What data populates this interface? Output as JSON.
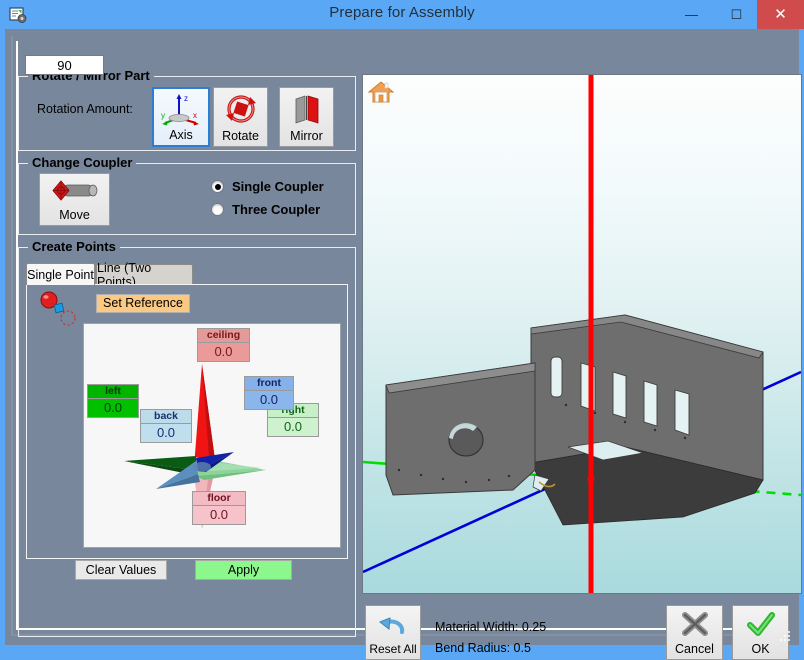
{
  "window": {
    "title": "Prepare for Assembly",
    "icon": "app-document-gear-icon",
    "minimize_label": "–",
    "maximize_label": "▭",
    "close_label": "✕"
  },
  "rotate_mirror_group": {
    "title": "Rotate / Mirror Part",
    "rotation_amount_label": "Rotation Amount:",
    "rotation_amount_value": "90",
    "buttons": [
      {
        "label": "Axis",
        "icon": "xyz-axis-icon",
        "selected": true
      },
      {
        "label": "Rotate",
        "icon": "circular-rotate-icon",
        "selected": false
      },
      {
        "label": "Mirror",
        "icon": "mirror-planes-icon",
        "selected": false
      }
    ]
  },
  "change_coupler_group": {
    "title": "Change Coupler",
    "move_button_label": "Move",
    "move_button_icon": "move-coupler-icon",
    "options": [
      {
        "label": "Single Coupler",
        "selected": true
      },
      {
        "label": "Three Coupler",
        "selected": false
      }
    ]
  },
  "create_points_group": {
    "title": "Create Points",
    "tabs": [
      {
        "label": "Single Point",
        "active": true
      },
      {
        "label": "Line (Two Points)",
        "active": false
      }
    ],
    "reference_icon": "point-reference-icon",
    "set_reference_label": "Set Reference",
    "axis_values": [
      {
        "key": "ceiling",
        "name": "ceiling",
        "value": "0.0"
      },
      {
        "key": "floor",
        "name": "floor",
        "value": "0.0"
      },
      {
        "key": "left",
        "name": "left",
        "value": "0.0"
      },
      {
        "key": "right",
        "name": "right",
        "value": "0.0"
      },
      {
        "key": "front",
        "name": "front",
        "value": "0.0"
      },
      {
        "key": "back",
        "name": "back",
        "value": "0.0"
      }
    ],
    "clear_values_label": "Clear Values",
    "apply_label": "Apply"
  },
  "viewport": {
    "home_icon": "home-icon",
    "model": "sheet-metal-bracket",
    "axis_colors": {
      "vertical": "#ff0000",
      "horizontal": "#00e000",
      "depth": "#0000d8"
    }
  },
  "footer": {
    "reset_label": "Reset All",
    "reset_icon": "undo-arrow-icon",
    "material_width": "Material Width: 0.25",
    "bend_radius": "Bend Radius: 0.5",
    "cancel_label": "Cancel",
    "cancel_icon": "x-cross-icon",
    "ok_label": "OK",
    "ok_icon": "check-mark-icon"
  },
  "colors": {
    "titlebar": "#5aa8f5",
    "dialog_bg": "#78879b",
    "close_btn": "#d04c4c",
    "apply_btn": "#8cf78c",
    "set_reference_btn": "#fcc983",
    "tab_active": "#f7f7f7"
  }
}
